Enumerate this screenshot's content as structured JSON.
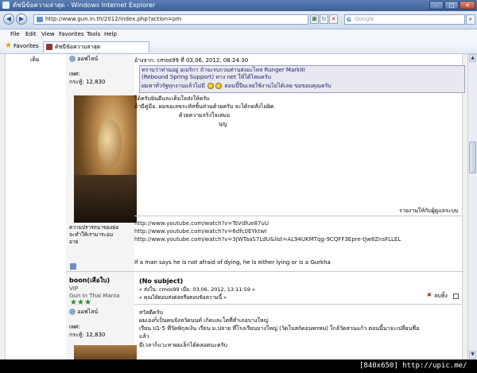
{
  "window": {
    "title": "ดัชนีข้อความล่าสุด - Windows Internet Explorer"
  },
  "address": {
    "url": "http://www.gun.in.th/2012/index.php?action=pm"
  },
  "search": {
    "placeholder": "Google",
    "engine_letter": "G"
  },
  "menu": {
    "items": [
      "File",
      "Edit",
      "View",
      "Favorites",
      "Tools",
      "Help"
    ]
  },
  "favorites": {
    "label": "Favorites",
    "tab_title": "ดัชนีข้อความล่าสุด"
  },
  "post1": {
    "member_status": "ออฟไลน์",
    "gender_label": "เพศ:",
    "posts": "กระทู้: 12,830",
    "more_label": "เต็ม",
    "quote_header": "อ้างจาก: cmos99 ที่  03,06, 2012, 08:24:30",
    "quote_lines": [
      "ทราบว่าท่านอยู่ อเมริกา ถ้าจะรบกวนท่านส่งอะไหล่ Runger MarkIII",
      " (Rebound Spring Support) ทาง  net  ให้ได้ไหมครับ",
      "ผมหาทั่วรัฐทุกงานแล้วไม่มี",
      "ตอนนี้ปืนเลยใช้งานไม่ได้เลย ขอขอบคุณครับ"
    ],
    "body_lines": [
      "ได้ครับยินดีและเต็มใจส่งให้ครับ",
      "ถ้ามีคู่มือ. ผมขอเลขระหัสชิ้นส่วนด้วยครับ จะได้กดสั่งไม่ผิด",
      "ด้วยความจริงใจเสมอ",
      "บุญ"
    ],
    "report_label": "รายงานให้กับผู้ดูแลระบบ",
    "avatar_caption": [
      "ความปรารถนาของพ่อ",
      "จะทำให้เรามาระอบ",
      "อาย"
    ],
    "links": [
      "http://www.youtube.com/watch?v=TsVdfue87uU",
      "http://www.youtube.com/watch?v=6dfc0EYktwI",
      "http://www.youtube.com/watch?v=3JWTaaS7LdU&list=AL94UKMTqg-9CQFF3Epre-tJw8ZnsFLLEL"
    ],
    "signature": "If a man says he is not afraid of dying, he is either lying or is a Gurkha"
  },
  "post2": {
    "author": "boon(เสือใบ)",
    "role": "VIP",
    "group": "Gun In Thai Mania",
    "stars": 3,
    "member_status": "ออฟไลน์",
    "gender_label": "เพศ:",
    "posts": "กระทู้: 12,830",
    "subject": "(No subject)",
    "sent_line": "« ส่งใน: cmos99 เมื่อ: 03,06, 2012, 13:11:59 »",
    "reply_line": "« คุณได้ตอบส่งต่อหรือตอบข้อความนี้ »",
    "delete_label": "ลบทิ้ง",
    "body_lines": [
      "สวัสดีครับ",
      "ผมเองก็เป็นคนจังหวัดนนท์ เกิดและโตที่ส่ำเถอบางใหญ่",
      "เรียน ป1-5 ที่วัดพิกุลเงิน เรียน ม.ปลาย ที่โรงเรียนบางใหญ่ (วัดโบสถ์ดอนพรหม) ใกล้วัดสวนแก้ว ตอนนี้นาจะเปลี่ยนชื่อ",
      "แล้ว",
      "มีเวลาก็แวะหาผมเล็กได้ตลอดนะครับ"
    ]
  },
  "footer": {
    "text": "[840x650] http://upic.me/"
  }
}
